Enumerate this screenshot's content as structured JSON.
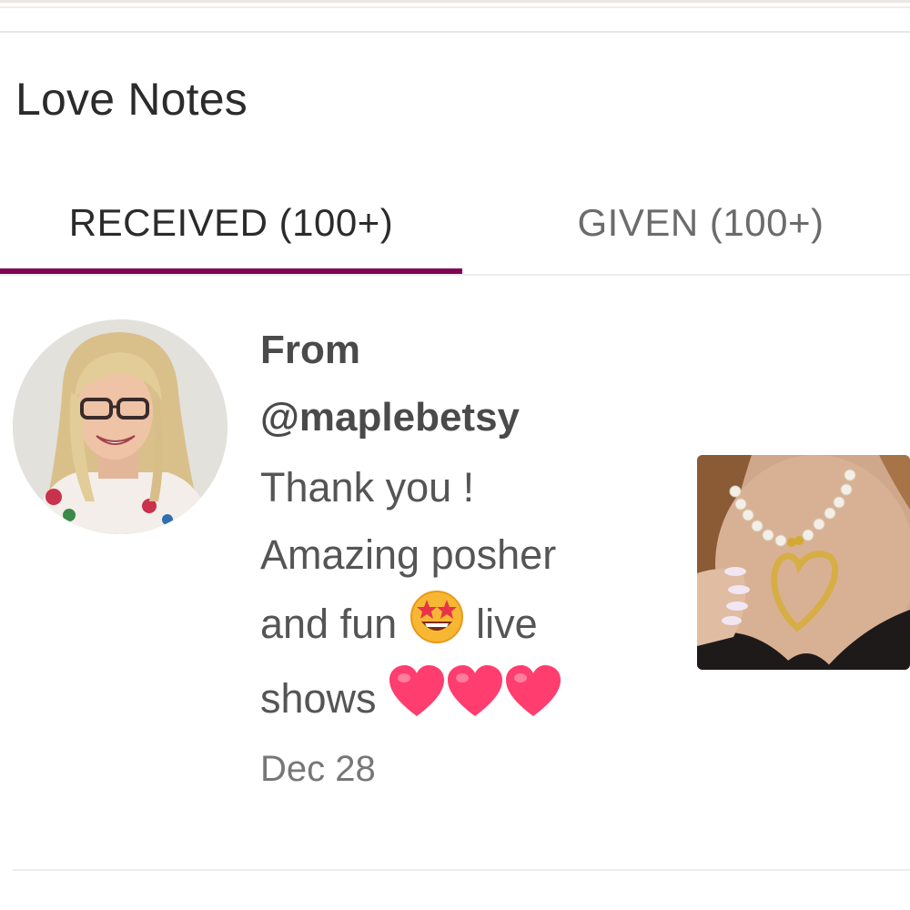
{
  "page": {
    "title": "Love Notes"
  },
  "tabs": [
    {
      "label": "RECEIVED (100+)",
      "active": true
    },
    {
      "label": "GIVEN (100+)",
      "active": false
    }
  ],
  "note": {
    "from_label": "From",
    "username": "@maplebetsy",
    "message_lines": [
      "Thank you !",
      "Amazing posher",
      "and fun",
      "live",
      "shows"
    ],
    "date": "Dec 28",
    "emojis": [
      "star-struck-emoji",
      "heart-emoji",
      "heart-emoji",
      "heart-emoji"
    ]
  },
  "colors": {
    "accent": "#7f0353",
    "heart": "#ff3d6e",
    "star_face": "#f7b733"
  }
}
